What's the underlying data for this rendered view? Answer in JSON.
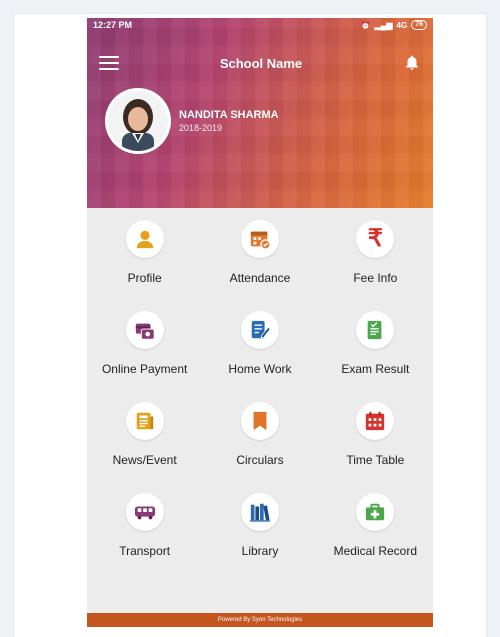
{
  "status": {
    "time": "12:27 PM",
    "network": "4G",
    "battery": "76"
  },
  "appbar": {
    "title": "School Name"
  },
  "student": {
    "name": "NANDITA SHARMA",
    "session": "2018-2019"
  },
  "menu": [
    {
      "label": "Profile",
      "icon": "person-icon",
      "color": "#e3a21a"
    },
    {
      "label": "Attendance",
      "icon": "calendar-check-icon",
      "color": "#e07a2e"
    },
    {
      "label": "Fee Info",
      "icon": "rupee-icon",
      "color": "#d6322e"
    },
    {
      "label": "Online Payment",
      "icon": "payment-icon",
      "color": "#8a3a73"
    },
    {
      "label": "Home Work",
      "icon": "homework-icon",
      "color": "#2a6cb3"
    },
    {
      "label": "Exam Result",
      "icon": "exam-result-icon",
      "color": "#4aa84a"
    },
    {
      "label": "News/Event",
      "icon": "news-icon",
      "color": "#e3a21a"
    },
    {
      "label": "Circulars",
      "icon": "bookmark-icon",
      "color": "#e0742a"
    },
    {
      "label": "Time Table",
      "icon": "timetable-icon",
      "color": "#d6322e"
    },
    {
      "label": "Transport",
      "icon": "bus-icon",
      "color": "#8a3a73"
    },
    {
      "label": "Library",
      "icon": "books-icon",
      "color": "#2a6cb3"
    },
    {
      "label": "Medical Record",
      "icon": "medical-kit-icon",
      "color": "#4aa84a"
    }
  ],
  "footer": {
    "text": "Powered By Syon Technologies"
  }
}
